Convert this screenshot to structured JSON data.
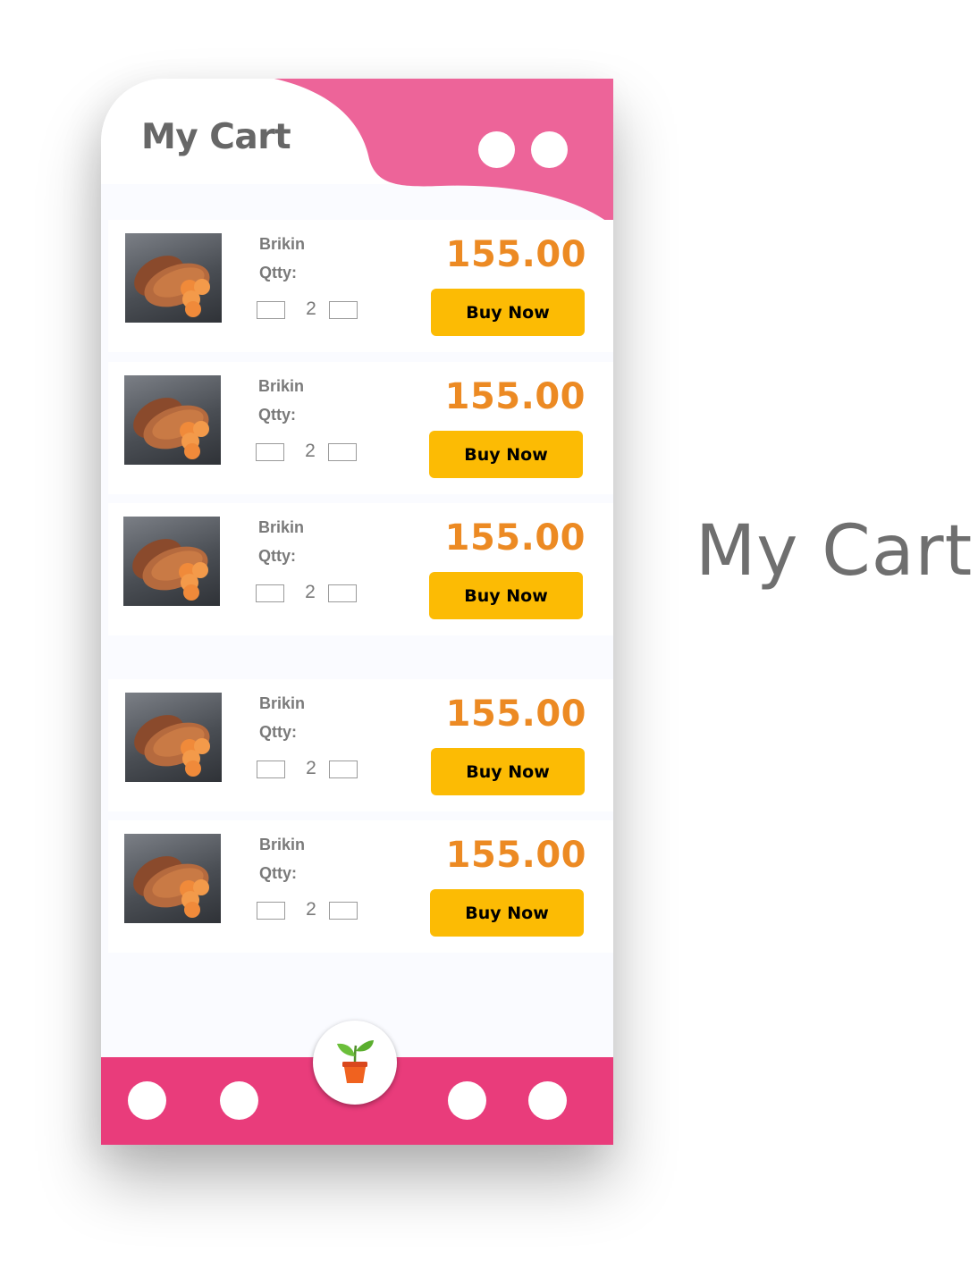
{
  "header": {
    "title": "My Cart",
    "accent_color": "#ed6499"
  },
  "cart_items": [
    {
      "name": "Brikin",
      "qty_label": "Qtty:",
      "qty": "2",
      "price": "155.00",
      "buy_label": "Buy Now"
    },
    {
      "name": "Brikin",
      "qty_label": "Qtty:",
      "qty": "2",
      "price": "155.00",
      "buy_label": "Buy Now"
    },
    {
      "name": "Brikin",
      "qty_label": "Qtty:",
      "qty": "2",
      "price": "155.00",
      "buy_label": "Buy Now"
    },
    {
      "name": "Brikin",
      "qty_label": "Qtty:",
      "qty": "2",
      "price": "155.00",
      "buy_label": "Buy Now"
    },
    {
      "name": "Brikin",
      "qty_label": "Qtty:",
      "qty": "2",
      "price": "155.00",
      "buy_label": "Buy Now"
    }
  ],
  "bottom_nav": {
    "color": "#e93c7b",
    "center_icon": "plant-pot-icon"
  },
  "side_caption": "My Cart",
  "colors": {
    "price": "#ec8a23",
    "button": "#fcbb04",
    "text": "#676767"
  }
}
